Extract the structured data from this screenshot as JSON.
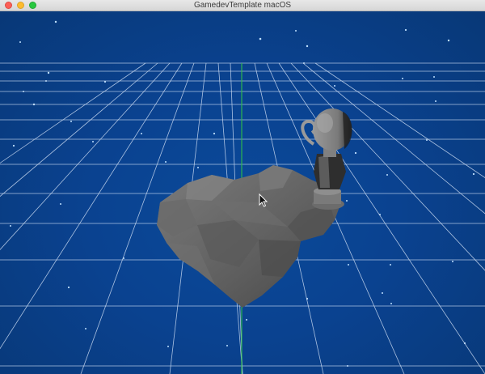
{
  "window": {
    "title": "GamedevTemplate macOS"
  },
  "colors": {
    "sky": "#0a4290",
    "grid_line": "#c8d8f0",
    "axis_line": "#2fbf4a",
    "rock": "#6e6e6e",
    "statue": "#8a8a8a"
  },
  "scene": {
    "icons": [
      "rock-model",
      "bust-statue-model",
      "mouse-cursor-icon"
    ]
  }
}
